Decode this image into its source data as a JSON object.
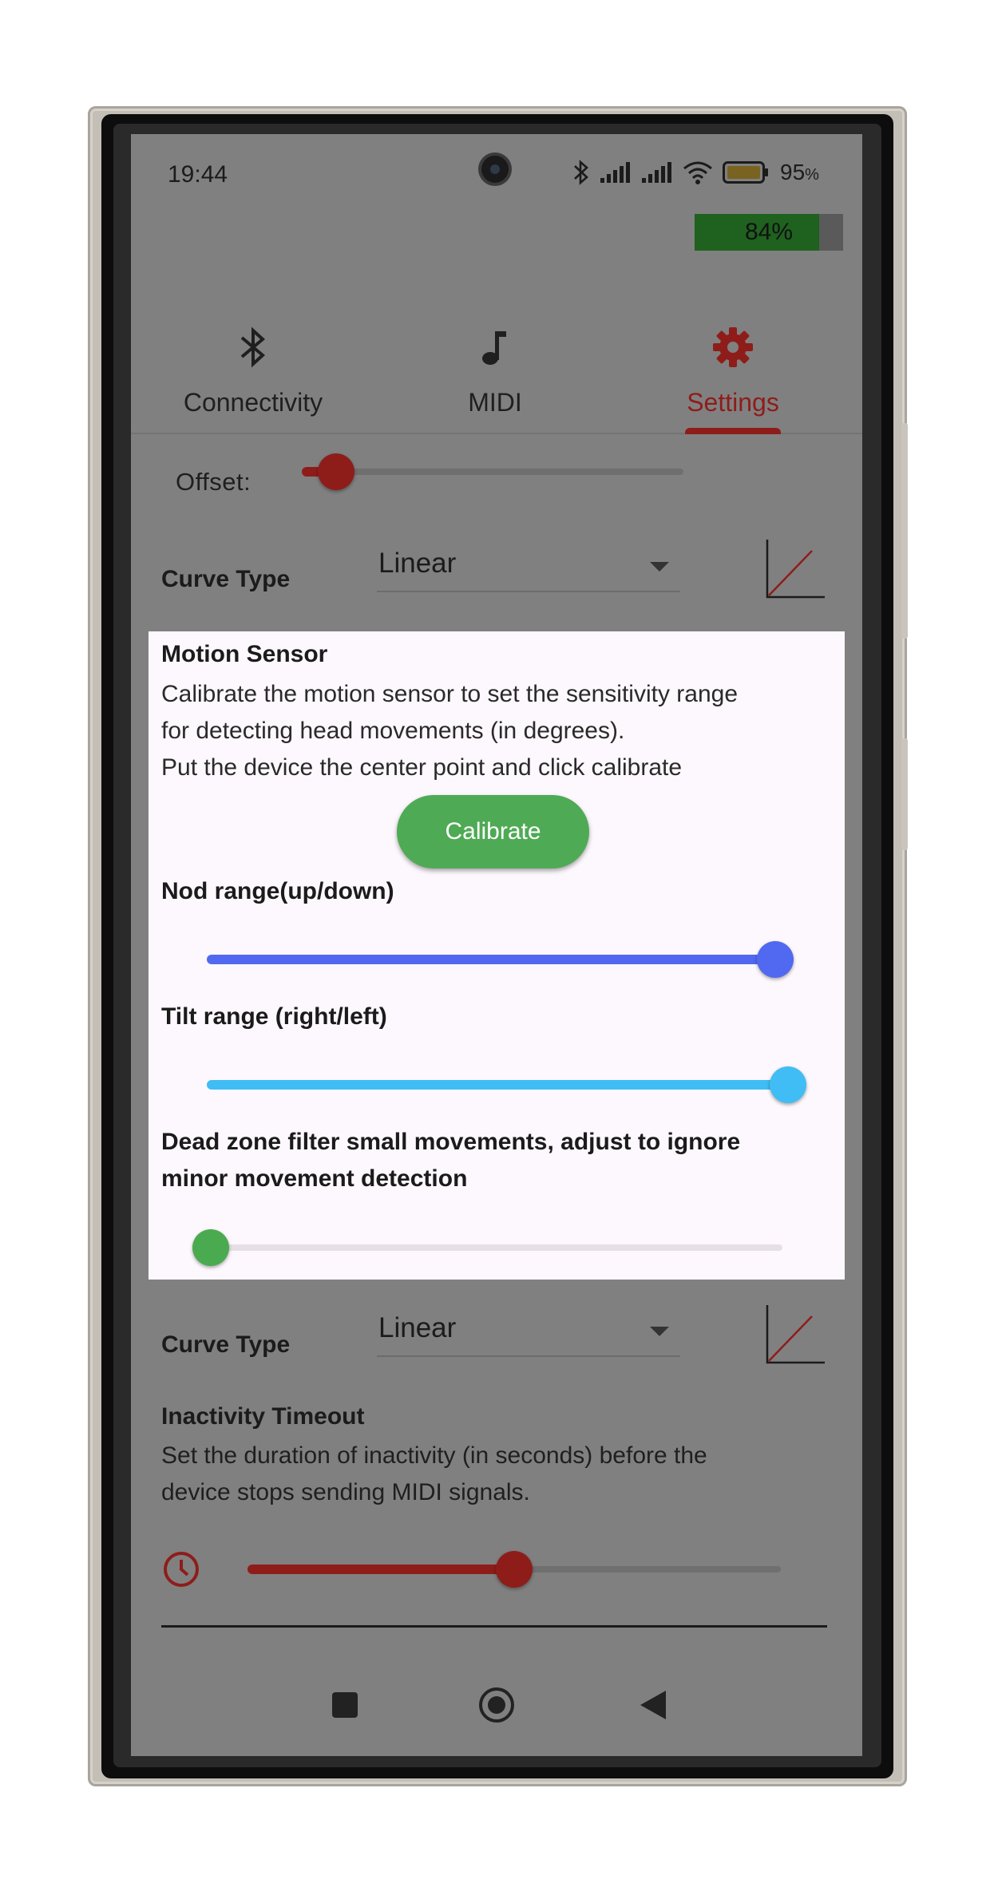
{
  "status_bar": {
    "time": "19:44",
    "battery_percent": "95",
    "battery_unit": "%"
  },
  "device_battery": {
    "label": "84%",
    "level": 0.84
  },
  "tabs": [
    {
      "label": "Connectivity",
      "icon": "bluetooth-icon",
      "active": false
    },
    {
      "label": "MIDI",
      "icon": "music-note-icon",
      "active": false
    },
    {
      "label": "Settings",
      "icon": "gear-icon",
      "active": true
    }
  ],
  "offset": {
    "label": "Offset:",
    "value": 0.09
  },
  "curve_type_1": {
    "label": "Curve Type",
    "value": "Linear"
  },
  "motion_sensor": {
    "title": "Motion Sensor",
    "description_line1": "Calibrate the motion sensor to set the sensitivity range",
    "description_line2": "for detecting head movements (in degrees).",
    "description_line3": "Put the device the center point and click calibrate",
    "calibrate_label": "Calibrate",
    "nod_label": "Nod range(up/down)",
    "nod_value": 1.0,
    "tilt_label": "Tilt range (right/left)",
    "tilt_value": 1.0,
    "deadzone_label_line1": "Dead zone filter small movements, adjust to ignore",
    "deadzone_label_line2": "minor movement detection",
    "deadzone_value": 0.0
  },
  "curve_type_2": {
    "label": "Curve Type",
    "value": "Linear"
  },
  "inactivity": {
    "title": "Inactivity Timeout",
    "description_line1": "Set the duration of inactivity (in seconds) before the",
    "description_line2": "device stops sending MIDI signals.",
    "value": 0.5
  },
  "colors": {
    "accent": "#8e1d1a",
    "nod": "#5169f0",
    "tilt": "#40bdf5",
    "deadzone": "#4aaa4f",
    "calibrate": "#4faa55",
    "screen_overlay": "#808080"
  }
}
